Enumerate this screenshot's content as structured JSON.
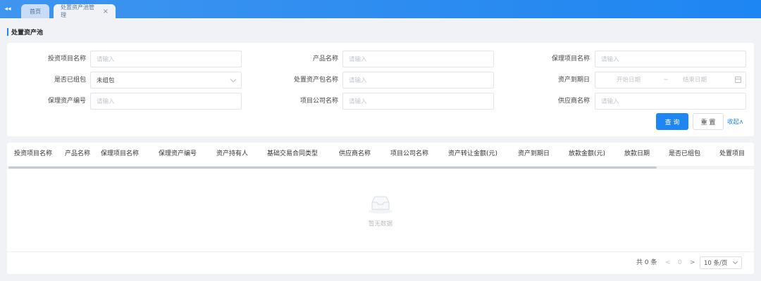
{
  "tabs": {
    "collapse_icon": "double-arrow-left-icon",
    "home_label": "首页",
    "active_label": "处置资产池管理",
    "close_glyph": "×"
  },
  "page": {
    "title": "处置资产池"
  },
  "search": {
    "fields": [
      {
        "label": "投资项目名称",
        "placeholder": "请输入",
        "value": ""
      },
      {
        "label": "产品名称",
        "placeholder": "请输入",
        "value": ""
      },
      {
        "label": "保理项目名称",
        "placeholder": "请输入",
        "value": ""
      },
      {
        "label": "是否已组包",
        "placeholder": "",
        "value": "未组包"
      },
      {
        "label": "处置资产包名称",
        "placeholder": "请输入",
        "value": ""
      },
      {
        "label": "资产到期日",
        "start_placeholder": "开始日期",
        "separator": "~",
        "end_placeholder": "结束日期"
      },
      {
        "label": "保理资产编号",
        "placeholder": "请输入",
        "value": ""
      },
      {
        "label": "项目公司名称",
        "placeholder": "请输入",
        "value": ""
      },
      {
        "label": "供应商名称",
        "placeholder": "请输入",
        "value": ""
      }
    ],
    "query_label": "查 询",
    "reset_label": "重 置",
    "collapse_label": "收起∧"
  },
  "table": {
    "columns": [
      "投资项目名称",
      "产品名称",
      "保理项目名称",
      "保理资产编号",
      "资产持有人",
      "基础交易合同类型",
      "供应商名称",
      "项目公司名称",
      "资产转让金额(元)",
      "资产到期日",
      "放款金额(元)",
      "放款日期",
      "是否已组包",
      "处置项目"
    ],
    "rows": [],
    "empty_text": "暂无数据"
  },
  "pagination": {
    "total_text": "共 0 条",
    "prev_glyph": "<",
    "current_page": "0",
    "next_glyph": ">",
    "page_size": "10 条/页"
  },
  "colors": {
    "primary": "#1e86f2",
    "header_bg": "#2b8bf0"
  }
}
